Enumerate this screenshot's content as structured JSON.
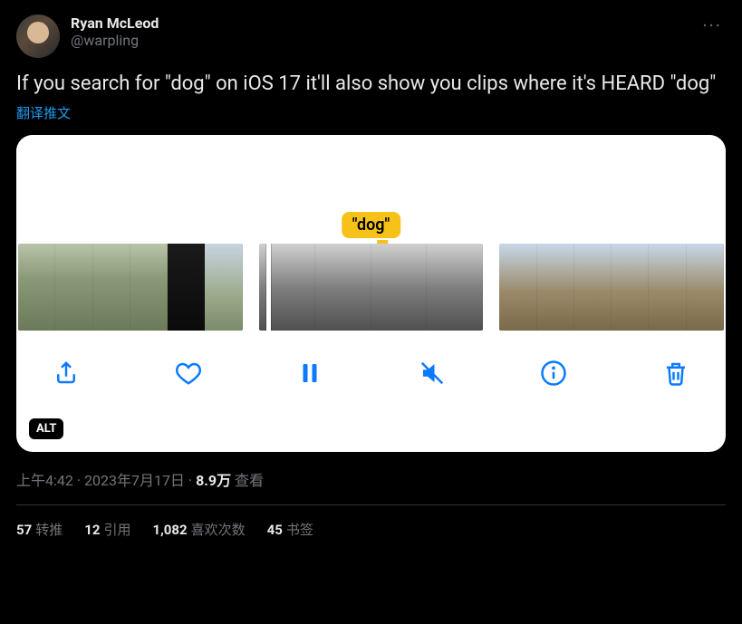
{
  "author": {
    "display_name": "Ryan McLeod",
    "handle": "@warpling"
  },
  "more_label": "···",
  "body": "If you search for \"dog\" on iOS 17 it'll also show you clips where it's HEARD \"dog\"",
  "translate_label": "翻译推文",
  "media": {
    "tooltip": "\"dog\"",
    "alt_badge": "ALT",
    "toolbar": {
      "share": "share",
      "like": "like",
      "pause": "pause",
      "mute": "mute",
      "info": "info",
      "delete": "delete"
    }
  },
  "meta": {
    "time": "上午4:42",
    "sep": " · ",
    "date": "2023年7月17日",
    "views_count": "8.9万",
    "views_label": " 查看"
  },
  "stats": {
    "retweets": {
      "count": "57",
      "label": "转推"
    },
    "quotes": {
      "count": "12",
      "label": "引用"
    },
    "likes": {
      "count": "1,082",
      "label": "喜欢次数"
    },
    "bookmarks": {
      "count": "45",
      "label": "书签"
    }
  }
}
